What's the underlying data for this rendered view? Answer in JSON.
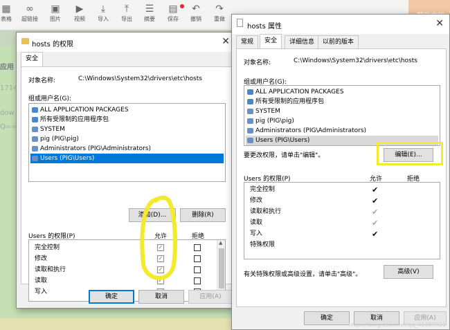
{
  "background": {
    "toolbar": [
      "表格",
      "超链接",
      "图片",
      "视频",
      "导入",
      "导出",
      "摘要",
      "保存",
      "撤销",
      "重做"
    ],
    "help_text": "帮助文档",
    "left_fragments": [
      "应用",
      "1714",
      "dow",
      "Q==,s"
    ]
  },
  "left_dialog": {
    "title": "hosts 的权限",
    "tab": "安全",
    "object_label": "对象名称:",
    "object_value": "C:\\Windows\\System32\\drivers\\etc\\hosts",
    "groups_label": "组或用户名(G):",
    "groups": [
      "ALL APPLICATION PACKAGES",
      "所有受限制的应用程序包",
      "SYSTEM",
      "pig (PIG\\pig)",
      "Administrators (PIG\\Administrators)",
      "Users (PIG\\Users)"
    ],
    "add_button": "添加(D)...",
    "remove_button": "删除(R)",
    "perm_header": "Users 的权限(P)",
    "allow": "允许",
    "deny": "拒绝",
    "permissions": [
      "完全控制",
      "修改",
      "读取和执行",
      "读取",
      "写入"
    ],
    "ok": "确定",
    "cancel": "取消",
    "apply": "应用(A)"
  },
  "right_dialog": {
    "title": "hosts 属性",
    "tabs": [
      "常规",
      "安全",
      "详细信息",
      "以前的版本"
    ],
    "object_label": "对象名称:",
    "object_value": "C:\\Windows\\System32\\drivers\\etc\\hosts",
    "groups_label": "组或用户名(G):",
    "groups": [
      "ALL APPLICATION PACKAGES",
      "所有受限制的应用程序包",
      "SYSTEM",
      "pig (PIG\\pig)",
      "Administrators (PIG\\Administrators)",
      "Users (PIG\\Users)"
    ],
    "edit_hint": "要更改权限，请单击\"编辑\"。",
    "edit_button": "编辑(E)...",
    "perm_header": "Users 的权限(P)",
    "allow": "允许",
    "deny": "拒绝",
    "permissions": [
      "完全控制",
      "修改",
      "读取和执行",
      "读取",
      "写入",
      "特殊权限"
    ],
    "advanced_hint": "有关特殊权限或高级设置，请单击\"高级\"。",
    "advanced_button": "高级(V)",
    "ok": "确定",
    "cancel": "取消",
    "apply": "应用(A)",
    "watermark": "https://blog.csdn.net/qq_41089021"
  }
}
